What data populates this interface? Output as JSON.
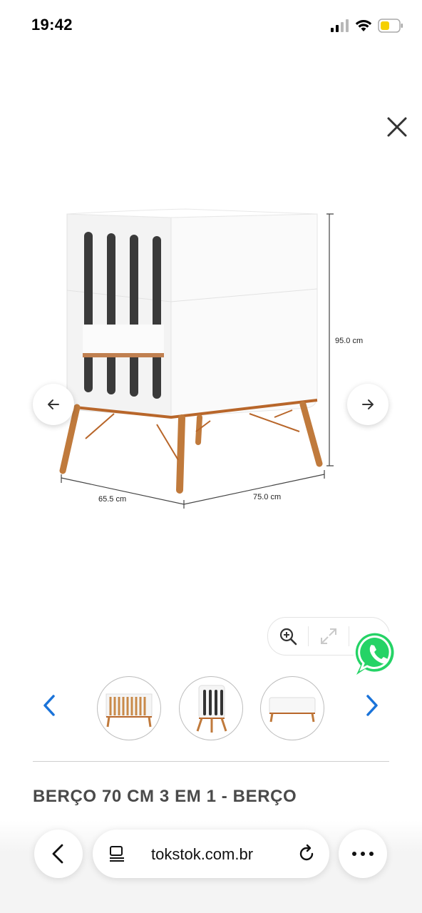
{
  "status": {
    "time": "19:42"
  },
  "product": {
    "dimensions": {
      "height": "95.0 cm",
      "depth": "65.5 cm",
      "width": "75.0 cm"
    },
    "title": "BERÇO 70 CM 3 EM 1 - BERÇO"
  },
  "browser": {
    "url": "tokstok.com.br"
  },
  "icons": {
    "close": "close-icon",
    "prev": "arrow-left-icon",
    "next": "arrow-right-icon",
    "zoom_in": "zoom-in-icon",
    "fullscreen": "expand-icon",
    "whatsapp": "whatsapp-icon",
    "back": "chevron-left-icon",
    "tabs": "reader-icon",
    "reload": "reload-icon",
    "more": "more-icon"
  },
  "colors": {
    "accent": "#1a73d9",
    "whatsapp": "#25d366",
    "wood": "#b8662a"
  }
}
